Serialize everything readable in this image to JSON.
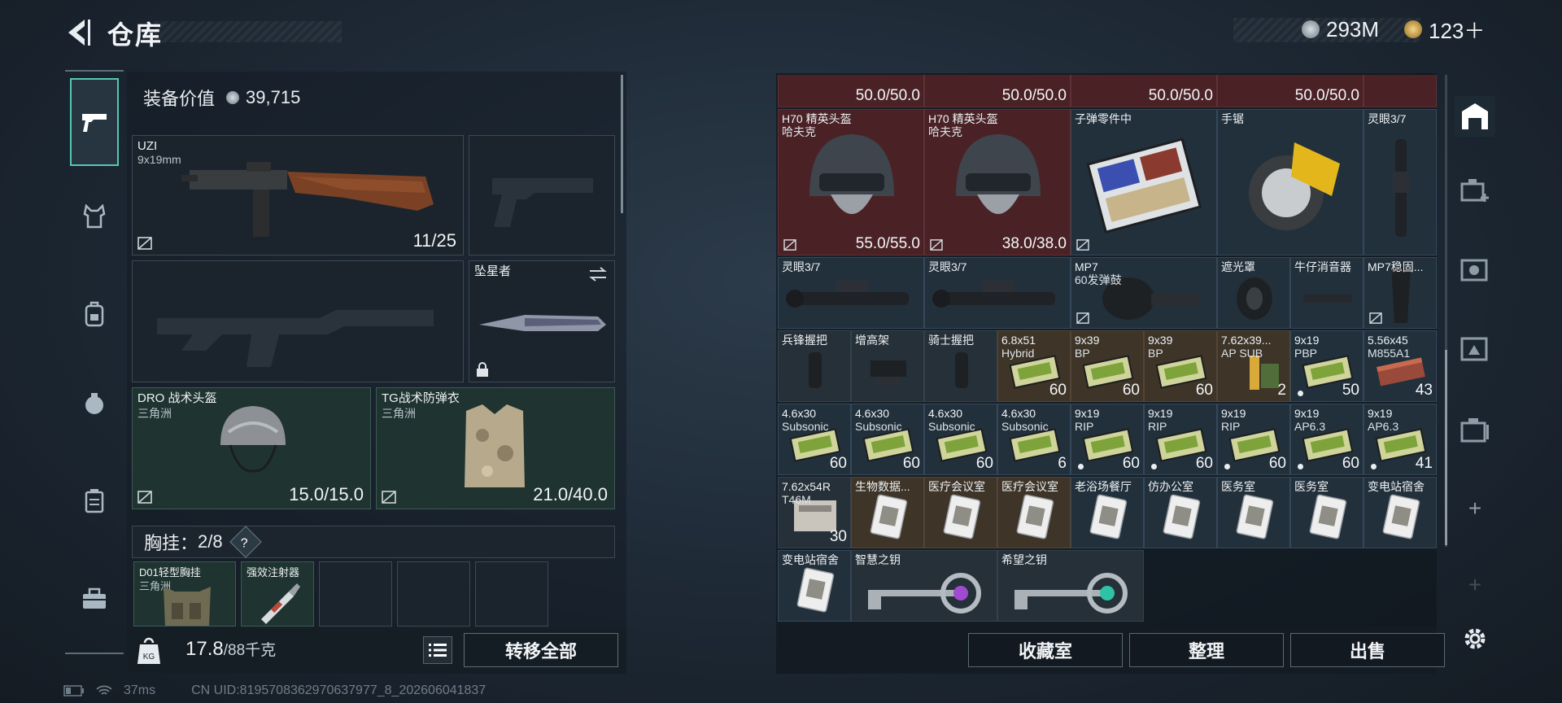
{
  "header": {
    "title": "仓库",
    "currency_a": "293M",
    "currency_b": "123＋"
  },
  "equipment": {
    "value_label": "装备价值",
    "value": "39,715"
  },
  "slots": {
    "primary": {
      "name": "UZI",
      "caliber": "9x19mm",
      "ammo": "11/25"
    },
    "melee": {
      "name": "坠星者"
    },
    "helmet": {
      "name": "DRO 战术头盔",
      "origin": "三角洲",
      "durability": "15.0/15.0"
    },
    "armor": {
      "name": "TG战术防弹衣",
      "origin": "三角洲",
      "durability": "21.0/40.0"
    }
  },
  "chest_rig": {
    "label": "胸挂：",
    "count": "2/8",
    "help": "?"
  },
  "rig_items": [
    {
      "name": "D01轻型胸挂",
      "sub": "三角洲"
    },
    {
      "name": "强效注射器",
      "sub": ""
    }
  ],
  "weight": {
    "current": "17.8",
    "max": "/88",
    "unit": "千克"
  },
  "transfer_all": "转移全部",
  "grid_rows": [
    [
      {
        "name": "",
        "sub": "",
        "qty": "50.0/50.0",
        "color": "red"
      },
      {
        "name": "",
        "sub": "",
        "qty": "50.0/50.0",
        "color": "red"
      },
      {
        "name": "",
        "sub": "",
        "qty": "50.0/50.0",
        "color": "red"
      },
      {
        "name": "",
        "sub": "",
        "qty": "50.0/50.0",
        "color": "red"
      },
      {
        "name": "",
        "sub": "",
        "qty": "",
        "color": "red"
      }
    ],
    [
      {
        "name": "H70 精英头盔",
        "sub": "哈夫克",
        "qty": "55.0/55.0",
        "color": "red",
        "icon": "helmet"
      },
      {
        "name": "H70 精英头盔",
        "sub": "哈夫克",
        "qty": "38.0/38.0",
        "color": "red",
        "icon": "helmet"
      },
      {
        "name": "子弹零件中",
        "sub": "",
        "qty": "",
        "color": "blue",
        "icon": "parts-box"
      },
      {
        "name": "手锯",
        "sub": "",
        "qty": "",
        "color": "blue",
        "icon": "saw"
      },
      {
        "name": "灵眼3/7",
        "sub": "",
        "qty": "",
        "color": "blue",
        "icon": "scope"
      }
    ],
    [
      {
        "name": "灵眼3/7",
        "sub": "",
        "qty": "",
        "color": "blue",
        "icon": "scope"
      },
      {
        "name": "灵眼3/7",
        "sub": "",
        "qty": "",
        "color": "blue",
        "icon": "scope"
      },
      {
        "name": "MP7",
        "sub": "60发弹鼓",
        "qty": "",
        "color": "blue",
        "icon": "drum"
      },
      {
        "name": "遮光罩",
        "sub": "",
        "qty": "",
        "color": "blue",
        "icon": "hood"
      },
      {
        "name": "牛仔消音器",
        "sub": "",
        "qty": "",
        "color": "blue",
        "icon": "suppressor"
      },
      {
        "name": "MP7稳固...",
        "sub": "",
        "qty": "",
        "color": "blue",
        "icon": "stock"
      }
    ],
    [
      {
        "name": "兵锋握把",
        "sub": "",
        "qty": "",
        "color": "gray",
        "icon": "grip"
      },
      {
        "name": "增高架",
        "sub": "",
        "qty": "",
        "color": "gray",
        "icon": "riser"
      },
      {
        "name": "骑士握把",
        "sub": "",
        "qty": "",
        "color": "gray",
        "icon": "grip"
      },
      {
        "name": "6.8x51",
        "sub": "Hybrid",
        "qty": "60",
        "color": "brown",
        "icon": "ammo"
      },
      {
        "name": "9x39",
        "sub": "BP",
        "qty": "60",
        "color": "brown",
        "icon": "ammo"
      },
      {
        "name": "9x39",
        "sub": "BP",
        "qty": "60",
        "color": "brown",
        "icon": "ammo"
      },
      {
        "name": "7.62x39...",
        "sub": "AP SUB",
        "qty": "2",
        "color": "brown",
        "icon": "ammo-green"
      },
      {
        "name": "9x19",
        "sub": "PBP",
        "qty": "50",
        "color": "blue",
        "icon": "ammo",
        "dot": true
      },
      {
        "name": "5.56x45",
        "sub": "M855A1",
        "qty": "43",
        "color": "blue",
        "icon": "ammo-red"
      }
    ],
    [
      {
        "name": "4.6x30",
        "sub": "Subsonic",
        "qty": "60",
        "color": "blue",
        "icon": "ammo"
      },
      {
        "name": "4.6x30",
        "sub": "Subsonic",
        "qty": "60",
        "color": "blue",
        "icon": "ammo"
      },
      {
        "name": "4.6x30",
        "sub": "Subsonic",
        "qty": "60",
        "color": "blue",
        "icon": "ammo"
      },
      {
        "name": "4.6x30",
        "sub": "Subsonic",
        "qty": "6",
        "color": "blue",
        "icon": "ammo"
      },
      {
        "name": "9x19",
        "sub": "RIP",
        "qty": "60",
        "color": "blue",
        "icon": "ammo",
        "dot": true
      },
      {
        "name": "9x19",
        "sub": "RIP",
        "qty": "60",
        "color": "blue",
        "icon": "ammo",
        "dot": true
      },
      {
        "name": "9x19",
        "sub": "RIP",
        "qty": "60",
        "color": "blue",
        "icon": "ammo",
        "dot": true
      },
      {
        "name": "9x19",
        "sub": "AP6.3",
        "qty": "60",
        "color": "blue",
        "icon": "ammo",
        "dot": true
      },
      {
        "name": "9x19",
        "sub": "AP6.3",
        "qty": "41",
        "color": "blue",
        "icon": "ammo",
        "dot": true
      }
    ],
    [
      {
        "name": "7.62x54R",
        "sub": "T46M",
        "qty": "30",
        "color": "gray",
        "icon": "ammo-box"
      },
      {
        "name": "生物数据...",
        "sub": "",
        "qty": "",
        "color": "brown",
        "icon": "keycard"
      },
      {
        "name": "医疗会议室",
        "sub": "",
        "qty": "",
        "color": "brown",
        "icon": "keycard"
      },
      {
        "name": "医疗会议室",
        "sub": "",
        "qty": "",
        "color": "brown",
        "icon": "keycard"
      },
      {
        "name": "老浴场餐厅",
        "sub": "",
        "qty": "",
        "color": "blue",
        "icon": "keycard"
      },
      {
        "name": "仿办公室",
        "sub": "",
        "qty": "",
        "color": "blue",
        "icon": "keycard"
      },
      {
        "name": "医务室",
        "sub": "",
        "qty": "",
        "color": "blue",
        "icon": "keycard"
      },
      {
        "name": "医务室",
        "sub": "",
        "qty": "",
        "color": "blue",
        "icon": "keycard"
      },
      {
        "name": "变电站宿舍",
        "sub": "",
        "qty": "",
        "color": "blue",
        "icon": "keycard"
      }
    ],
    [
      {
        "name": "变电站宿舍",
        "sub": "",
        "qty": "",
        "color": "blue",
        "icon": "keycard"
      },
      {
        "name": "智慧之钥",
        "sub": "",
        "qty": "",
        "color": "purple",
        "icon": "key-purple"
      },
      {
        "name": "希望之钥",
        "sub": "",
        "qty": "",
        "color": "purple",
        "icon": "key-teal"
      }
    ]
  ],
  "right_buttons": {
    "collection": "收藏室",
    "organize": "整理",
    "sell": "出售"
  },
  "status": {
    "ping": "37ms",
    "uid": "CN UID:8195708362970637977_8_202606041837"
  },
  "colors": {
    "accent": "#54c8b4",
    "red_cell": "#4a2226",
    "brown_cell": "#3e3428",
    "blue_cell": "#22303c"
  }
}
